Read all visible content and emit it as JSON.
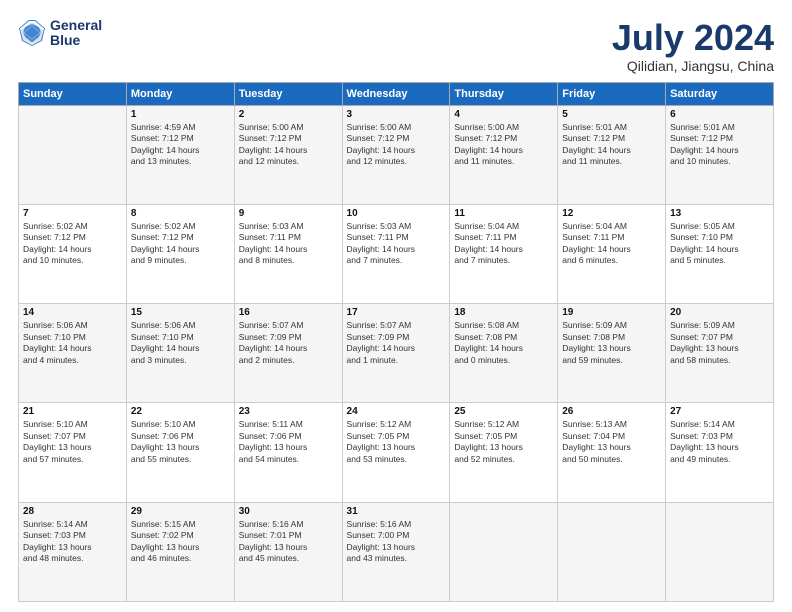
{
  "header": {
    "logo_line1": "General",
    "logo_line2": "Blue",
    "title": "July 2024",
    "subtitle": "Qilidian, Jiangsu, China"
  },
  "days_of_week": [
    "Sunday",
    "Monday",
    "Tuesday",
    "Wednesday",
    "Thursday",
    "Friday",
    "Saturday"
  ],
  "weeks": [
    [
      {
        "day": "",
        "info": ""
      },
      {
        "day": "1",
        "info": "Sunrise: 4:59 AM\nSunset: 7:12 PM\nDaylight: 14 hours\nand 13 minutes."
      },
      {
        "day": "2",
        "info": "Sunrise: 5:00 AM\nSunset: 7:12 PM\nDaylight: 14 hours\nand 12 minutes."
      },
      {
        "day": "3",
        "info": "Sunrise: 5:00 AM\nSunset: 7:12 PM\nDaylight: 14 hours\nand 12 minutes."
      },
      {
        "day": "4",
        "info": "Sunrise: 5:00 AM\nSunset: 7:12 PM\nDaylight: 14 hours\nand 11 minutes."
      },
      {
        "day": "5",
        "info": "Sunrise: 5:01 AM\nSunset: 7:12 PM\nDaylight: 14 hours\nand 11 minutes."
      },
      {
        "day": "6",
        "info": "Sunrise: 5:01 AM\nSunset: 7:12 PM\nDaylight: 14 hours\nand 10 minutes."
      }
    ],
    [
      {
        "day": "7",
        "info": "Sunrise: 5:02 AM\nSunset: 7:12 PM\nDaylight: 14 hours\nand 10 minutes."
      },
      {
        "day": "8",
        "info": "Sunrise: 5:02 AM\nSunset: 7:12 PM\nDaylight: 14 hours\nand 9 minutes."
      },
      {
        "day": "9",
        "info": "Sunrise: 5:03 AM\nSunset: 7:11 PM\nDaylight: 14 hours\nand 8 minutes."
      },
      {
        "day": "10",
        "info": "Sunrise: 5:03 AM\nSunset: 7:11 PM\nDaylight: 14 hours\nand 7 minutes."
      },
      {
        "day": "11",
        "info": "Sunrise: 5:04 AM\nSunset: 7:11 PM\nDaylight: 14 hours\nand 7 minutes."
      },
      {
        "day": "12",
        "info": "Sunrise: 5:04 AM\nSunset: 7:11 PM\nDaylight: 14 hours\nand 6 minutes."
      },
      {
        "day": "13",
        "info": "Sunrise: 5:05 AM\nSunset: 7:10 PM\nDaylight: 14 hours\nand 5 minutes."
      }
    ],
    [
      {
        "day": "14",
        "info": "Sunrise: 5:06 AM\nSunset: 7:10 PM\nDaylight: 14 hours\nand 4 minutes."
      },
      {
        "day": "15",
        "info": "Sunrise: 5:06 AM\nSunset: 7:10 PM\nDaylight: 14 hours\nand 3 minutes."
      },
      {
        "day": "16",
        "info": "Sunrise: 5:07 AM\nSunset: 7:09 PM\nDaylight: 14 hours\nand 2 minutes."
      },
      {
        "day": "17",
        "info": "Sunrise: 5:07 AM\nSunset: 7:09 PM\nDaylight: 14 hours\nand 1 minute."
      },
      {
        "day": "18",
        "info": "Sunrise: 5:08 AM\nSunset: 7:08 PM\nDaylight: 14 hours\nand 0 minutes."
      },
      {
        "day": "19",
        "info": "Sunrise: 5:09 AM\nSunset: 7:08 PM\nDaylight: 13 hours\nand 59 minutes."
      },
      {
        "day": "20",
        "info": "Sunrise: 5:09 AM\nSunset: 7:07 PM\nDaylight: 13 hours\nand 58 minutes."
      }
    ],
    [
      {
        "day": "21",
        "info": "Sunrise: 5:10 AM\nSunset: 7:07 PM\nDaylight: 13 hours\nand 57 minutes."
      },
      {
        "day": "22",
        "info": "Sunrise: 5:10 AM\nSunset: 7:06 PM\nDaylight: 13 hours\nand 55 minutes."
      },
      {
        "day": "23",
        "info": "Sunrise: 5:11 AM\nSunset: 7:06 PM\nDaylight: 13 hours\nand 54 minutes."
      },
      {
        "day": "24",
        "info": "Sunrise: 5:12 AM\nSunset: 7:05 PM\nDaylight: 13 hours\nand 53 minutes."
      },
      {
        "day": "25",
        "info": "Sunrise: 5:12 AM\nSunset: 7:05 PM\nDaylight: 13 hours\nand 52 minutes."
      },
      {
        "day": "26",
        "info": "Sunrise: 5:13 AM\nSunset: 7:04 PM\nDaylight: 13 hours\nand 50 minutes."
      },
      {
        "day": "27",
        "info": "Sunrise: 5:14 AM\nSunset: 7:03 PM\nDaylight: 13 hours\nand 49 minutes."
      }
    ],
    [
      {
        "day": "28",
        "info": "Sunrise: 5:14 AM\nSunset: 7:03 PM\nDaylight: 13 hours\nand 48 minutes."
      },
      {
        "day": "29",
        "info": "Sunrise: 5:15 AM\nSunset: 7:02 PM\nDaylight: 13 hours\nand 46 minutes."
      },
      {
        "day": "30",
        "info": "Sunrise: 5:16 AM\nSunset: 7:01 PM\nDaylight: 13 hours\nand 45 minutes."
      },
      {
        "day": "31",
        "info": "Sunrise: 5:16 AM\nSunset: 7:00 PM\nDaylight: 13 hours\nand 43 minutes."
      },
      {
        "day": "",
        "info": ""
      },
      {
        "day": "",
        "info": ""
      },
      {
        "day": "",
        "info": ""
      }
    ]
  ]
}
